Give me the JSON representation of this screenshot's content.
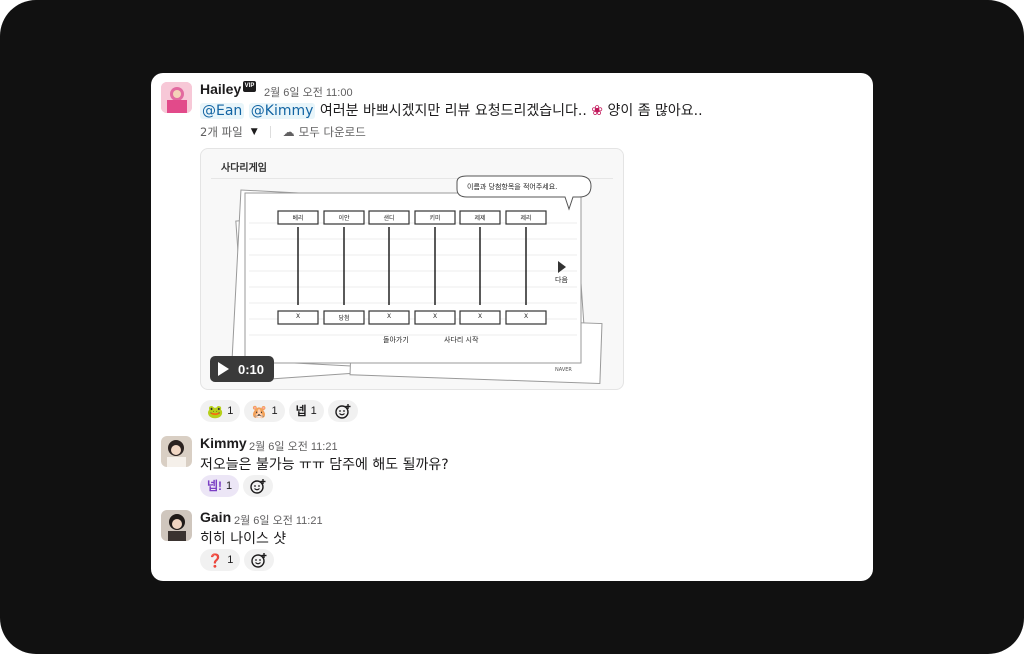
{
  "messages": [
    {
      "author": "Hailey",
      "badge": "VIP",
      "time": "2월 6일 오전 11:00",
      "mentions": [
        "@Ean",
        "@Kimmy"
      ],
      "text": "여러분 바쁘시겠지만 리뷰 요청드리겠습니다..",
      "text_after": "양이 좀 많아요..",
      "files_count": "2개 파일",
      "download_all": "모두 다운로드",
      "preview": {
        "title": "사다리게임",
        "speech": "이름과 당첨항목을 적어주세요.",
        "names": [
          "베리",
          "이안",
          "샌디",
          "키미",
          "제제",
          "제리"
        ],
        "results": [
          "X",
          "당첨",
          "X",
          "X",
          "X",
          "X"
        ],
        "next": "다음",
        "back": "돌아가기",
        "start": "사다리 시작",
        "brand": "NAVER",
        "duration": "0:10"
      },
      "reactions": [
        {
          "emoji": "🐸",
          "count": "1"
        },
        {
          "emoji": "🐹",
          "count": "1"
        },
        {
          "emoji": "넵",
          "count": "1"
        }
      ]
    },
    {
      "author": "Kimmy",
      "time": "2월 6일 오전 11:21",
      "text": "저오늘은 불가능 ㅠㅠ 담주에 해도 될까유?",
      "reactions": [
        {
          "emoji": "넵!",
          "count": "1"
        }
      ]
    },
    {
      "author": "Gain",
      "time": "2월 6일 오전 11:21",
      "text": "히히 나이스 샷",
      "reactions": [
        {
          "emoji": "❓",
          "count": "1"
        }
      ]
    }
  ],
  "colors": {
    "mention": "#1264a3",
    "background": "#111111",
    "card": "#ffffff"
  }
}
